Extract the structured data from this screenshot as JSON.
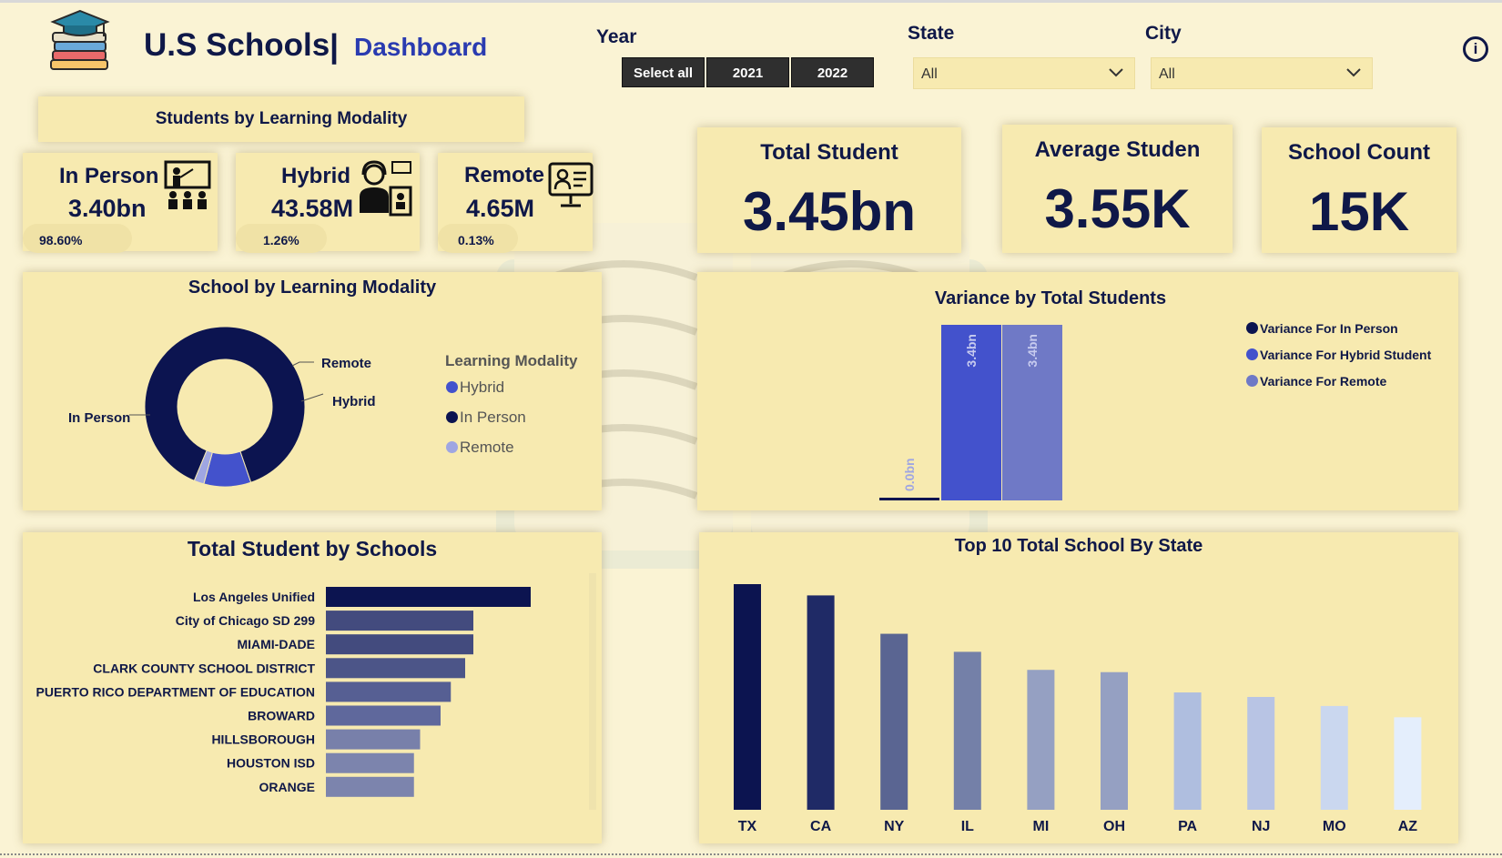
{
  "header": {
    "title": "U.S Schools",
    "separator": "|",
    "subtitle": "Dashboard",
    "info_icon": "i"
  },
  "filters": {
    "year_label": "Year",
    "year_buttons": [
      "Select all",
      "2021",
      "2022"
    ],
    "state_label": "State",
    "state_value": "All",
    "city_label": "City",
    "city_value": "All"
  },
  "modality": {
    "title": "Students by Learning Modality",
    "cards": [
      {
        "name": "In Person",
        "value": "3.40bn",
        "pct": "98.60%",
        "icon": "classroom-teacher-icon"
      },
      {
        "name": "Hybrid",
        "value": "43.58M",
        "pct": "1.26%",
        "icon": "hybrid-learner-icon"
      },
      {
        "name": "Remote",
        "value": "4.65M",
        "pct": "0.13%",
        "icon": "remote-monitor-icon"
      }
    ]
  },
  "kpis": [
    {
      "label": "Total Student",
      "value": "3.45bn"
    },
    {
      "label": "Average Studen",
      "value": "3.55K"
    },
    {
      "label": "School Count",
      "value": "15K"
    }
  ],
  "colors": {
    "dark_navy": "#0c1450",
    "hybrid_blue": "#4352cc",
    "remote_lavender": "#9fa6e2",
    "panel_bg": "#f7eab0",
    "page_bg": "#faf3d4"
  },
  "donut": {
    "title": "School by Learning Modality",
    "legend_title": "Learning Modality",
    "legend": [
      "Hybrid",
      "In Person",
      "Remote"
    ],
    "labels": {
      "in_person": "In Person",
      "hybrid": "Hybrid",
      "remote": "Remote"
    }
  },
  "variance": {
    "title": "Variance by Total Students",
    "legend": [
      "Variance For In Person",
      "Variance For Hybrid Student",
      "Variance For Remote"
    ],
    "bar_labels": [
      "0.0bn",
      "3.4bn",
      "3.4bn"
    ]
  },
  "hbar": {
    "title": "Total Student by Schools"
  },
  "columns": {
    "title": "Top 10 Total School By State"
  },
  "chart_data": [
    {
      "type": "pie",
      "title": "School by Learning Modality",
      "categories": [
        "In Person",
        "Hybrid",
        "Remote"
      ],
      "values": [
        88.5,
        9.5,
        2.0
      ],
      "colors": [
        "#0c1450",
        "#4352cc",
        "#9fa6e2"
      ],
      "legend": "right"
    },
    {
      "type": "bar",
      "title": "Variance by Total Students",
      "categories": [
        "Variance For In Person",
        "Variance For Hybrid Student",
        "Variance For Remote"
      ],
      "values": [
        0.0,
        3.4,
        3.4
      ],
      "colors": [
        "#0c1450",
        "#4352cc",
        "#6f79c6"
      ],
      "legend": "top-right"
    },
    {
      "type": "bar",
      "orientation": "horizontal",
      "title": "Total Student by Schools",
      "categories": [
        "Los Angeles Unified",
        "City of Chicago SD 299",
        "MIAMI-DADE",
        "CLARK COUNTY SCHOOL DISTRICT",
        "PUERTO RICO DEPARTMENT OF EDUCATION",
        "BROWARD",
        "HILLSBOROUGH",
        "HOUSTON ISD",
        "ORANGE"
      ],
      "values": [
        100,
        72,
        72,
        68,
        61,
        56,
        46,
        43,
        43
      ],
      "colors": [
        "#0c1450",
        "#434b7e",
        "#434b7e",
        "#4c5588",
        "#565f93",
        "#5f689c",
        "#7880aa",
        "#7c84ad",
        "#7c84ad"
      ]
    },
    {
      "type": "bar",
      "title": "Top 10 Total School By State",
      "categories": [
        "TX",
        "CA",
        "NY",
        "IL",
        "MI",
        "OH",
        "PA",
        "NJ",
        "MO",
        "AZ"
      ],
      "values": [
        100,
        95,
        78,
        70,
        62,
        61,
        52,
        50,
        46,
        41
      ],
      "colors": [
        "#0c1450",
        "#1f2a66",
        "#5a6592",
        "#7480a8",
        "#95a0c2",
        "#95a0c2",
        "#afbedf",
        "#b8c4e4",
        "#cad7ef",
        "#e4eefc"
      ]
    }
  ]
}
